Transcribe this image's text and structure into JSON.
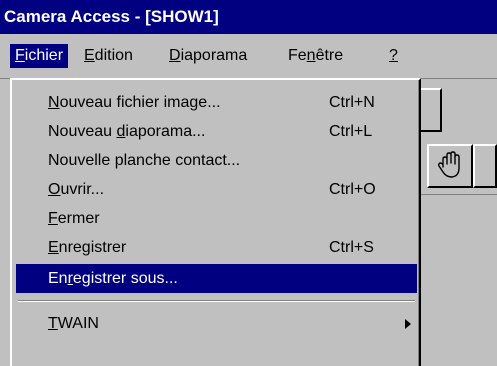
{
  "window": {
    "title": "Camera Access - [SHOW1]"
  },
  "menubar": {
    "items": [
      {
        "label": "Fichier",
        "mnemonic": "F",
        "rest": "ichier"
      },
      {
        "label": "Edition",
        "mnemonic": "E",
        "rest": "dition"
      },
      {
        "label": "Diaporama",
        "mnemonic": "D",
        "rest": "iaporama"
      },
      {
        "label": "Fenêtre",
        "pre": "Fe",
        "mnemonic": "n",
        "rest": "être"
      },
      {
        "label": "?",
        "mnemonic": "?"
      }
    ]
  },
  "dropdown": {
    "items": [
      {
        "pre": "",
        "mn": "N",
        "post": "ouveau fichier image...",
        "shortcut": "Ctrl+N"
      },
      {
        "pre": "Nouveau ",
        "mn": "d",
        "post": "iaporama...",
        "shortcut": "Ctrl+L"
      },
      {
        "pre": "Nouvelle planche contact...",
        "mn": "",
        "post": "",
        "shortcut": ""
      },
      {
        "pre": "",
        "mn": "O",
        "post": "uvrir...",
        "shortcut": "Ctrl+O"
      },
      {
        "pre": "",
        "mn": "F",
        "post": "ermer",
        "shortcut": ""
      },
      {
        "pre": "",
        "mn": "E",
        "post": "nregistrer",
        "shortcut": "Ctrl+S"
      },
      {
        "pre": "En",
        "mn": "r",
        "post": "egistrer sous...",
        "shortcut": ""
      },
      {
        "pre": "",
        "mn": "T",
        "post": "WAIN",
        "shortcut": ""
      }
    ],
    "highlighted_index": 6
  },
  "toolbar": {
    "hand_tool_icon": "hand-icon"
  },
  "colors": {
    "title_bg": "#000080",
    "menu_bg": "#c0c0c0",
    "highlight": "#000080"
  }
}
